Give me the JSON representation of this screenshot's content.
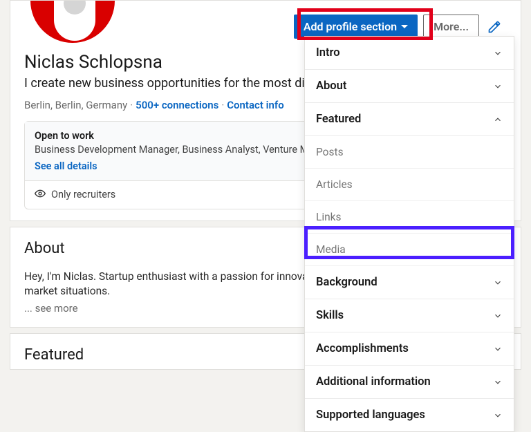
{
  "header": {
    "add_profile_label": "Add profile section",
    "more_label": "More..."
  },
  "profile": {
    "name": "Niclas Schlopsna",
    "headline": "I create new business opportunities for the most disru             industry players.",
    "location": "Berlin, Berlin, Germany",
    "connections": "500+ connections",
    "contact_info": "Contact info"
  },
  "open_to_work": {
    "title": "Open to work",
    "roles": "Business Development Manager, Business Analyst, Venture Mana   Entrepreneurship roles",
    "see_all": "See all details",
    "visibility": "Only recruiters"
  },
  "about": {
    "title": "About",
    "body": "Hey, I'm Niclas. Startup enthusiast with a passion for innovation tre             learner, adapting fast to emerging market situations.",
    "see_more": "... see more"
  },
  "featured": {
    "title": "Featured"
  },
  "dropdown": {
    "intro": "Intro",
    "about": "About",
    "featured": "Featured",
    "posts": "Posts",
    "articles": "Articles",
    "links": "Links",
    "media": "Media",
    "background": "Background",
    "skills": "Skills",
    "accomplishments": "Accomplishments",
    "additional_info": "Additional information",
    "supported_languages": "Supported languages"
  }
}
